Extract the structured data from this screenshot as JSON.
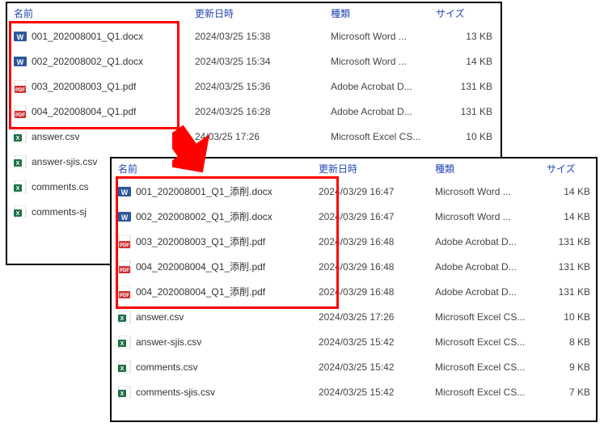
{
  "columns": {
    "name": "名前",
    "date": "更新日時",
    "type": "種類",
    "size": "サイズ"
  },
  "back": {
    "rows": [
      {
        "icon": "word",
        "name": "001_202008001_Q1.docx",
        "date": "2024/03/25 15:38",
        "type": "Microsoft Word ...",
        "size": "13 KB"
      },
      {
        "icon": "word",
        "name": "002_202008002_Q1.docx",
        "date": "2024/03/25 15:34",
        "type": "Microsoft Word ...",
        "size": "14 KB"
      },
      {
        "icon": "pdf",
        "name": "003_202008003_Q1.pdf",
        "date": "2024/03/25 15:36",
        "type": "Adobe Acrobat D...",
        "size": "131 KB"
      },
      {
        "icon": "pdf",
        "name": "004_202008004_Q1.pdf",
        "date": "2024/03/25 16:28",
        "type": "Adobe Acrobat D...",
        "size": "131 KB"
      },
      {
        "icon": "excel",
        "name": "answer.csv",
        "date": "24/03/25 17:26",
        "type": "Microsoft Excel CS...",
        "size": "10 KB"
      },
      {
        "icon": "excel",
        "name": "answer-sjis.csv",
        "date": "",
        "type": "",
        "size": ""
      },
      {
        "icon": "excel",
        "name": "comments.cs",
        "date": "",
        "type": "",
        "size": ""
      },
      {
        "icon": "excel",
        "name": "comments-sj",
        "date": "",
        "type": "",
        "size": ""
      }
    ]
  },
  "front": {
    "rows": [
      {
        "icon": "word",
        "name": "001_202008001_Q1_添削.docx",
        "date": "2024/03/29 16:47",
        "type": "Microsoft Word ...",
        "size": "14 KB"
      },
      {
        "icon": "word",
        "name": "002_202008002_Q1_添削.docx",
        "date": "2024/03/29 16:47",
        "type": "Microsoft Word ...",
        "size": "14 KB"
      },
      {
        "icon": "pdf",
        "name": "003_202008003_Q1_添削.pdf",
        "date": "2024/03/29 16:48",
        "type": "Adobe Acrobat D...",
        "size": "131 KB"
      },
      {
        "icon": "pdf",
        "name": "004_202008004_Q1_添削.pdf",
        "date": "2024/03/29 16:48",
        "type": "Adobe Acrobat D...",
        "size": "131 KB"
      },
      {
        "icon": "pdf",
        "name": "004_202008004_Q1_添削.pdf",
        "date": "2024/03/29 16:48",
        "type": "Adobe Acrobat D...",
        "size": "131 KB"
      },
      {
        "icon": "excel",
        "name": "answer.csv",
        "date": "2024/03/25 17:26",
        "type": "Microsoft Excel CS...",
        "size": "10 KB"
      },
      {
        "icon": "excel",
        "name": "answer-sjis.csv",
        "date": "2024/03/25 15:42",
        "type": "Microsoft Excel CS...",
        "size": "8 KB"
      },
      {
        "icon": "excel",
        "name": "comments.csv",
        "date": "2024/03/25 15:42",
        "type": "Microsoft Excel CS...",
        "size": "9 KB"
      },
      {
        "icon": "excel",
        "name": "comments-sjis.csv",
        "date": "2024/03/25 15:42",
        "type": "Microsoft Excel CS...",
        "size": "7 KB"
      }
    ]
  }
}
